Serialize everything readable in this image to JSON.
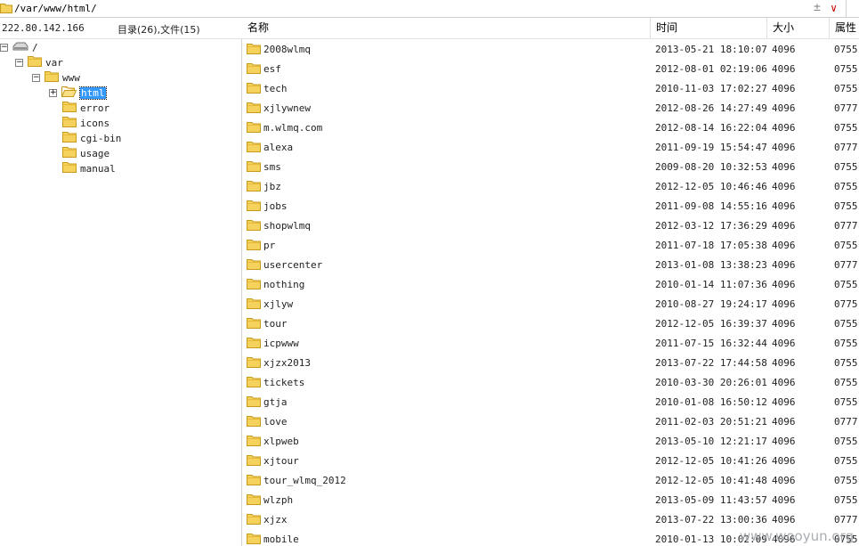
{
  "path": "/var/www/html/",
  "tree": {
    "host": "222.80.142.166",
    "counts": "目录(26),文件(15)",
    "nodes": [
      {
        "label": "/",
        "icon": "drive-icon",
        "toggle": "−"
      },
      {
        "label": "var",
        "icon": "folder-icon",
        "toggle": "−"
      },
      {
        "label": "www",
        "icon": "folder-icon",
        "toggle": "−"
      },
      {
        "label": "html",
        "icon": "folder-open-icon",
        "toggle": "+",
        "selected": true
      },
      {
        "label": "error",
        "icon": "folder-icon"
      },
      {
        "label": "icons",
        "icon": "folder-icon"
      },
      {
        "label": "cgi-bin",
        "icon": "folder-icon"
      },
      {
        "label": "usage",
        "icon": "folder-icon"
      },
      {
        "label": "manual",
        "icon": "folder-icon"
      }
    ]
  },
  "columns": {
    "name": "名称",
    "time": "时间",
    "size": "大小",
    "perm": "属性"
  },
  "files": [
    {
      "name": "2008wlmq",
      "time": "2013-05-21 18:10:07",
      "size": "4096",
      "perm": "0755"
    },
    {
      "name": "esf",
      "time": "2012-08-01 02:19:06",
      "size": "4096",
      "perm": "0755"
    },
    {
      "name": "tech",
      "time": "2010-11-03 17:02:27",
      "size": "4096",
      "perm": "0755"
    },
    {
      "name": "xjlywnew",
      "time": "2012-08-26 14:27:49",
      "size": "4096",
      "perm": "0777"
    },
    {
      "name": "m.wlmq.com",
      "time": "2012-08-14 16:22:04",
      "size": "4096",
      "perm": "0755"
    },
    {
      "name": "alexa",
      "time": "2011-09-19 15:54:47",
      "size": "4096",
      "perm": "0777"
    },
    {
      "name": "sms",
      "time": "2009-08-20 10:32:53",
      "size": "4096",
      "perm": "0755"
    },
    {
      "name": "jbz",
      "time": "2012-12-05 10:46:46",
      "size": "4096",
      "perm": "0755"
    },
    {
      "name": "jobs",
      "time": "2011-09-08 14:55:16",
      "size": "4096",
      "perm": "0755"
    },
    {
      "name": "shopwlmq",
      "time": "2012-03-12 17:36:29",
      "size": "4096",
      "perm": "0777"
    },
    {
      "name": "pr",
      "time": "2011-07-18 17:05:38",
      "size": "4096",
      "perm": "0755"
    },
    {
      "name": "usercenter",
      "time": "2013-01-08 13:38:23",
      "size": "4096",
      "perm": "0777"
    },
    {
      "name": "nothing",
      "time": "2010-01-14 11:07:36",
      "size": "4096",
      "perm": "0755"
    },
    {
      "name": "xjlyw",
      "time": "2010-08-27 19:24:17",
      "size": "4096",
      "perm": "0775"
    },
    {
      "name": "tour",
      "time": "2012-12-05 16:39:37",
      "size": "4096",
      "perm": "0755"
    },
    {
      "name": "icpwww",
      "time": "2011-07-15 16:32:44",
      "size": "4096",
      "perm": "0755"
    },
    {
      "name": "xjzx2013",
      "time": "2013-07-22 17:44:58",
      "size": "4096",
      "perm": "0755"
    },
    {
      "name": "tickets",
      "time": "2010-03-30 20:26:01",
      "size": "4096",
      "perm": "0755"
    },
    {
      "name": "gtja",
      "time": "2010-01-08 16:50:12",
      "size": "4096",
      "perm": "0755"
    },
    {
      "name": "love",
      "time": "2011-02-03 20:51:21",
      "size": "4096",
      "perm": "0777"
    },
    {
      "name": "xlpweb",
      "time": "2013-05-10 12:21:17",
      "size": "4096",
      "perm": "0755"
    },
    {
      "name": "xjtour",
      "time": "2012-12-05 10:41:26",
      "size": "4096",
      "perm": "0755"
    },
    {
      "name": "tour_wlmq_2012",
      "time": "2012-12-05 10:41:48",
      "size": "4096",
      "perm": "0755"
    },
    {
      "name": "wlzph",
      "time": "2013-05-09 11:43:57",
      "size": "4096",
      "perm": "0755"
    },
    {
      "name": "xjzx",
      "time": "2013-07-22 13:00:36",
      "size": "4096",
      "perm": "0777"
    },
    {
      "name": "mobile",
      "time": "2010-01-13 10:02:09",
      "size": "4096",
      "perm": "0755"
    }
  ],
  "watermark": "www.wooyun.org",
  "colors": {
    "folder": "#f5d25c",
    "folder_edge": "#c79a1c",
    "selection": "#3399ff"
  }
}
